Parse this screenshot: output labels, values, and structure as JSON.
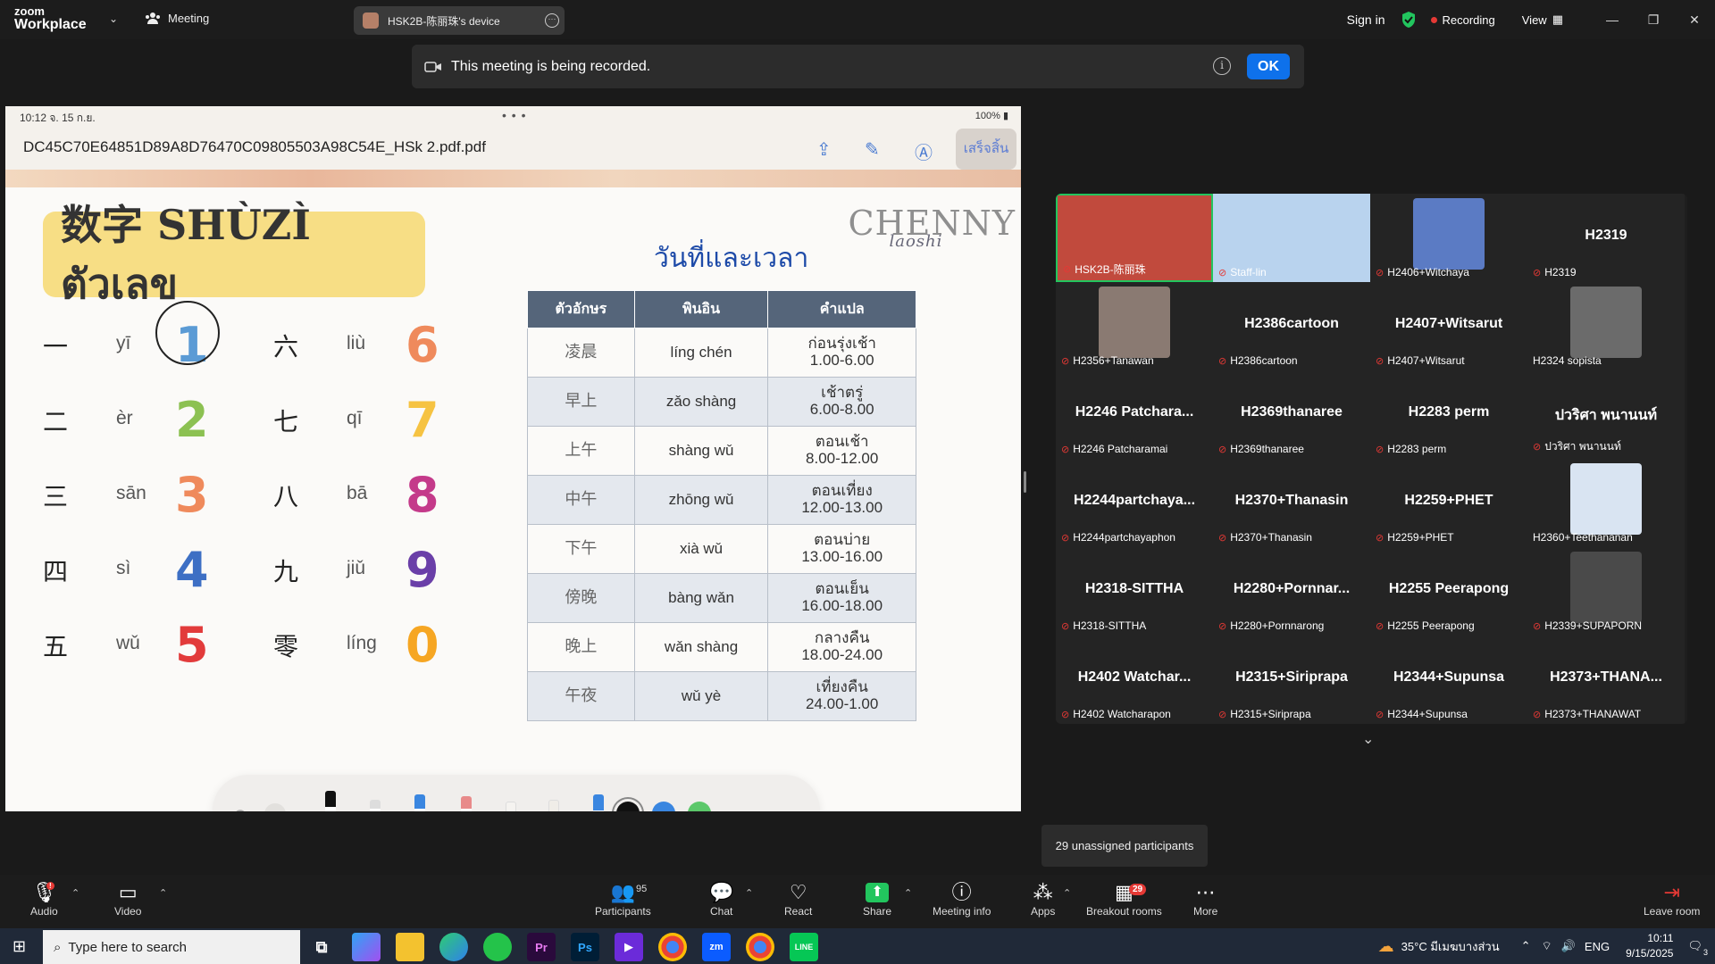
{
  "titlebar": {
    "brand_top": "zoom",
    "brand_bottom": "Workplace",
    "meeting_label": "Meeting",
    "device_tab": "HSK2B-陈丽珠's device",
    "sign_in": "Sign in",
    "recording": "Recording",
    "view": "View"
  },
  "banner": {
    "text": "This meeting is being recorded.",
    "ok": "OK"
  },
  "shared": {
    "status_time": "10:12  จ. 15 ก.ย.",
    "status_right": "100%",
    "file_name": "DC45C70E64851D89A8D76470C09805503A98C54E_HSk 2.pdf.pdf",
    "done_label": "เสร็จสิ้น",
    "slide_title": "数字 SHÙZÌ ตัวเลข",
    "brand": "CHENNY",
    "brand_sub": "laoshi",
    "numbers": [
      {
        "hz": "一",
        "py": "yī",
        "d": "1",
        "c": "#5b9bd5"
      },
      {
        "hz": "六",
        "py": "liù",
        "d": "6",
        "c": "#ef8a5c"
      },
      {
        "hz": "二",
        "py": "èr",
        "d": "2",
        "c": "#8cc152"
      },
      {
        "hz": "七",
        "py": "qī",
        "d": "7",
        "c": "#f6c342"
      },
      {
        "hz": "三",
        "py": "sān",
        "d": "3",
        "c": "#ef8a5c"
      },
      {
        "hz": "八",
        "py": "bā",
        "d": "8",
        "c": "#c43a8a"
      },
      {
        "hz": "四",
        "py": "sì",
        "d": "4",
        "c": "#3d6fc4"
      },
      {
        "hz": "九",
        "py": "jiǔ",
        "d": "9",
        "c": "#6a3fa8"
      },
      {
        "hz": "五",
        "py": "wǔ",
        "d": "5",
        "c": "#e23b3b"
      },
      {
        "hz": "零",
        "py": "líng",
        "d": "0",
        "c": "#f6a623"
      }
    ],
    "table_title": "วันที่และเวลา",
    "table_headers": [
      "ตัวอักษร",
      "พินอิน",
      "คำแปล"
    ],
    "table_rows": [
      {
        "hz": "凌晨",
        "py": "líng chén",
        "th": "ก่อนรุ่งเช้า",
        "time": "1.00-6.00"
      },
      {
        "hz": "早上",
        "py": "zǎo shàng",
        "th": "เช้าตรู่",
        "time": "6.00-8.00"
      },
      {
        "hz": "上午",
        "py": "shàng wǔ",
        "th": "ตอนเช้า",
        "time": "8.00-12.00"
      },
      {
        "hz": "中午",
        "py": "zhōng wǔ",
        "th": "ตอนเที่ยง",
        "time": "12.00-13.00"
      },
      {
        "hz": "下午",
        "py": "xià wǔ",
        "th": "ตอนบ่าย",
        "time": "13.00-16.00"
      },
      {
        "hz": "傍晚",
        "py": "bàng wǎn",
        "th": "ตอนเย็น",
        "time": "16.00-18.00"
      },
      {
        "hz": "晚上",
        "py": "wǎn shàng",
        "th": "กลางคืน",
        "time": "18.00-24.00"
      },
      {
        "hz": "午夜",
        "py": "wǔ yè",
        "th": "เที่ยงคืน",
        "time": "24.00-1.00"
      }
    ],
    "swatches": [
      "#111111",
      "#3a86e0",
      "#5cc86a",
      "#f2c530",
      "#e0303a",
      "#c084fc"
    ]
  },
  "gallery": {
    "tiles": [
      {
        "name": "",
        "label": "HSK2B-陈丽珠",
        "pic": true,
        "color": "#c14a3d",
        "active": true
      },
      {
        "name": "",
        "label": "Staff-lin",
        "pic": true,
        "color": "#b9d3ee"
      },
      {
        "name": "",
        "label": "H2406+Witchaya",
        "pic": true,
        "color": "#5b7bc4"
      },
      {
        "name": "H2319",
        "label": "H2319"
      },
      {
        "name": "",
        "label": "H2356+Tanawan",
        "pic": true,
        "color": "#8a7a72"
      },
      {
        "name": "H2386cartoon",
        "label": "H2386cartoon"
      },
      {
        "name": "H2407+Witsarut",
        "label": "H2407+Witsarut"
      },
      {
        "name": "",
        "label": "H2324 sopista",
        "pic": true,
        "color": "#6b6b6b"
      },
      {
        "name": "H2246 Patchara...",
        "label": "H2246 Patcharamai"
      },
      {
        "name": "H2369thanaree",
        "label": "H2369thanaree"
      },
      {
        "name": "H2283 perm",
        "label": "H2283 perm"
      },
      {
        "name": "ปวริศา พนานนท์",
        "label": "ปวริศา พนานนท์"
      },
      {
        "name": "H2244partchaya...",
        "label": "H2244partchayaphon"
      },
      {
        "name": "H2370+Thanasin",
        "label": "H2370+Thanasin"
      },
      {
        "name": "H2259+PHET",
        "label": "H2259+PHET"
      },
      {
        "name": "",
        "label": "H2360+Teethananan",
        "pic": true,
        "color": "#d9e4f2"
      },
      {
        "name": "H2318-SITTHA",
        "label": "H2318-SITTHA"
      },
      {
        "name": "H2280+Pornnar...",
        "label": "H2280+Pornnarong"
      },
      {
        "name": "H2255 Peerapong",
        "label": "H2255 Peerapong"
      },
      {
        "name": "",
        "label": "H2339+SUPAPORN",
        "pic": true,
        "color": "#4a4a4a"
      },
      {
        "name": "H2402 Watchar...",
        "label": "H2402 Watcharapon"
      },
      {
        "name": "H2315+Siriprapa",
        "label": "H2315+Siriprapa"
      },
      {
        "name": "H2344+Supunsa",
        "label": "H2344+Supunsa"
      },
      {
        "name": "H2373+THANA...",
        "label": "H2373+THANAWAT"
      }
    ],
    "unassigned": "29 unassigned participants"
  },
  "toolbar": {
    "audio": "Audio",
    "video": "Video",
    "participants": "Participants",
    "participants_count": "95",
    "chat": "Chat",
    "react": "React",
    "share": "Share",
    "meeting_info": "Meeting info",
    "apps": "Apps",
    "breakout": "Breakout rooms",
    "breakout_count": "29",
    "more": "More",
    "leave": "Leave room"
  },
  "taskbar": {
    "search_placeholder": "Type here to search",
    "weather": "35°C  มีเมฆบางส่วน",
    "lang": "ENG",
    "time": "10:11",
    "date": "9/15/2025",
    "notif_count": "3"
  }
}
